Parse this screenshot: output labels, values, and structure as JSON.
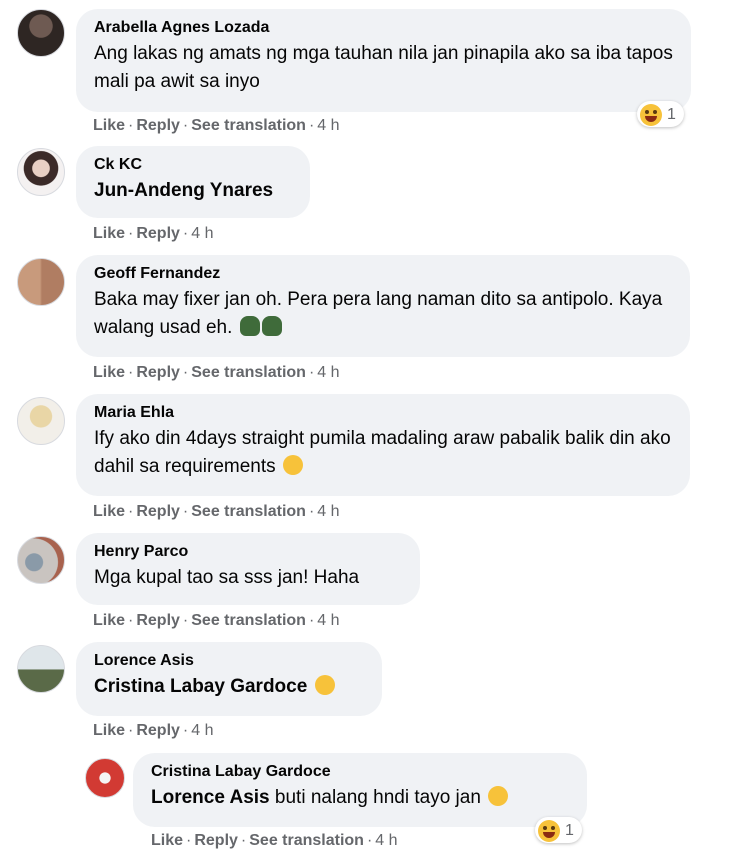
{
  "actions": {
    "like": "Like",
    "reply": "Reply",
    "see_translation": "See translation",
    "separator": "·"
  },
  "comments": [
    {
      "author": "Arabella Agnes Lozada",
      "text": "Ang lakas ng amats ng mga tauhan nila jan pinapila ako sa iba tapos mali pa awit sa inyo",
      "time": "4 h",
      "reaction_count": "1"
    },
    {
      "author": "Ck KC",
      "mention": "Jun-Andeng Ynares",
      "time": "4 h"
    },
    {
      "author": "Geoff Fernandez",
      "text": "Baka may fixer jan oh. Pera pera lang naman dito sa antipolo. Kaya walang usad eh.",
      "time": "4 h"
    },
    {
      "author": "Maria Ehla",
      "text": "Ify ako din 4days straight pumila madaling araw pabalik balik din ako dahil sa requirements",
      "time": "4 h"
    },
    {
      "author": "Henry Parco",
      "text": "Mga kupal tao sa sss jan! Haha",
      "time": "4 h"
    },
    {
      "author": "Lorence Asis",
      "mention": "Cristina Labay Gardoce",
      "time": "4 h"
    },
    {
      "author": "Cristina Labay Gardoce",
      "mention": "Lorence Asis",
      "text": "buti nalang hndi tayo jan",
      "time": "4 h",
      "reaction_count": "1"
    }
  ],
  "colors": {
    "bubble": "#f0f2f5",
    "meta_text": "#65676b",
    "body_text": "#050505",
    "emoji_yellow": "#f7c23a"
  },
  "icons": [
    "laughing-face-icon",
    "facepalm-emoji-icon",
    "wink-emoji-icon",
    "smile-emoji-icon",
    "rolling-laughing-emoji-icon"
  ]
}
